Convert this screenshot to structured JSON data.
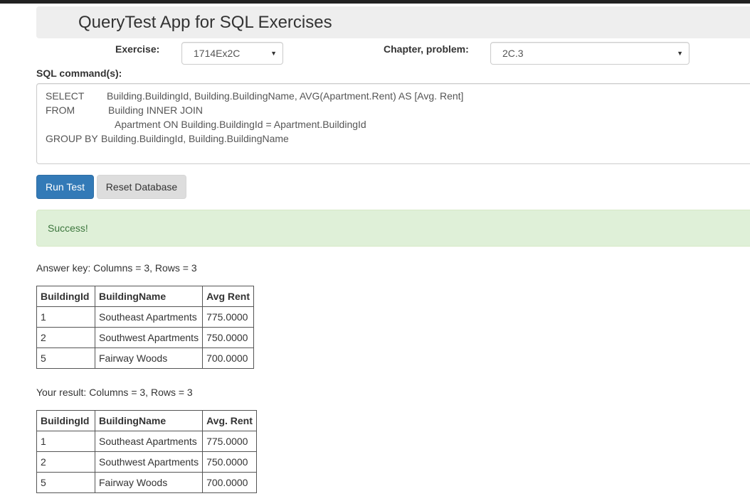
{
  "app": {
    "title": "QueryTest App for SQL Exercises"
  },
  "form": {
    "exercise_label": "Exercise:",
    "exercise_value": "1714Ex2C",
    "chapter_label": "Chapter, problem:",
    "chapter_value": "2C.3",
    "sql_label": "SQL command(s):",
    "sql_lines": [
      {
        "kw": "SELECT",
        "text": "Building.BuildingId, Building.BuildingName, AVG(Apartment.Rent) AS [Avg. Rent]"
      },
      {
        "kw": "FROM",
        "text": "Building INNER JOIN"
      },
      {
        "kw": "",
        "text": "Apartment ON Building.BuildingId = Apartment.BuildingId"
      },
      {
        "kw": "GROUP BY",
        "text": "Building.BuildingId, Building.BuildingName"
      }
    ]
  },
  "buttons": {
    "run": "Run Test",
    "reset": "Reset Database"
  },
  "status": {
    "message": "Success!"
  },
  "answer_key": {
    "summary": "Answer key: Columns = 3, Rows = 3",
    "headers": [
      "BuildingId",
      "BuildingName",
      "Avg Rent"
    ],
    "rows": [
      [
        "1",
        "Southeast Apartments",
        "775.0000"
      ],
      [
        "2",
        "Southwest Apartments",
        "750.0000"
      ],
      [
        "5",
        "Fairway Woods",
        "700.0000"
      ]
    ]
  },
  "your_result": {
    "summary": "Your result: Columns = 3, Rows = 3",
    "headers": [
      "BuildingId",
      "BuildingName",
      "Avg. Rent"
    ],
    "rows": [
      [
        "1",
        "Southeast Apartments",
        "775.0000"
      ],
      [
        "2",
        "Southwest Apartments",
        "750.0000"
      ],
      [
        "5",
        "Fairway Woods",
        "700.0000"
      ]
    ]
  },
  "icons": {
    "select_caret": "chevron-down-icon"
  },
  "colors": {
    "primary": "#337ab7",
    "success_bg": "#dff0d8",
    "success_text": "#3c763d"
  }
}
